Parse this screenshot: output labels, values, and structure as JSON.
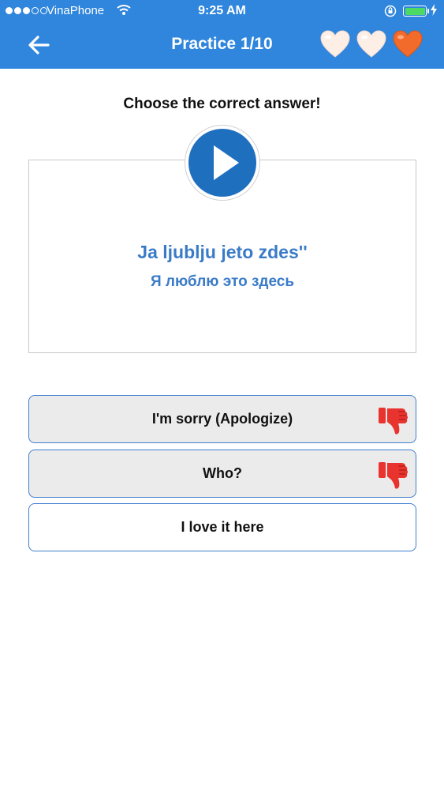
{
  "status_bar": {
    "carrier": "VinaPhone",
    "time": "9:25 AM"
  },
  "nav": {
    "title": "Practice 1/10"
  },
  "lives": {
    "hearts": [
      "pale-heart-icon",
      "pale-heart-icon",
      "orange-heart-icon"
    ]
  },
  "quiz": {
    "prompt": "Choose the correct answer!",
    "phrase_latin": "Ja ljublju jeto zdes''",
    "phrase_cyrillic": "Я люблю это здесь",
    "options": [
      {
        "label": "I'm sorry (Apologize)",
        "state": "wrong",
        "icon": "thumbs-down-icon"
      },
      {
        "label": "Who?",
        "state": "wrong",
        "icon": "thumbs-down-icon"
      },
      {
        "label": "I love it here",
        "state": "unanswered"
      }
    ]
  },
  "colors": {
    "header_blue": "#2f86dc",
    "accent_text": "#3a7bc8",
    "play_blue": "#1f6fbf",
    "wrong_red": "#e8332e",
    "option_border": "#3f7fcf"
  }
}
